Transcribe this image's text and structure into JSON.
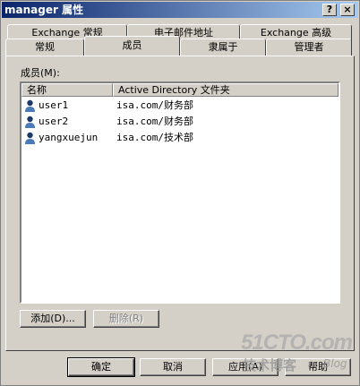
{
  "window": {
    "title": "manager 属性",
    "help": "?",
    "close": "×"
  },
  "tabs_back": [
    "Exchange 常规",
    "电子邮件地址",
    "Exchange 高级"
  ],
  "tabs_front": [
    "常规",
    "成员",
    "隶属于",
    "管理者"
  ],
  "members_label": "成员(M):",
  "columns": [
    "名称",
    "Active Directory 文件夹"
  ],
  "members": [
    {
      "name": "user1",
      "folder": "isa.com/财务部"
    },
    {
      "name": "user2",
      "folder": "isa.com/财务部"
    },
    {
      "name": "yangxuejun",
      "folder": "isa.com/技术部"
    }
  ],
  "buttons": {
    "add": "添加(D)...",
    "remove": "删除(R)"
  },
  "footer": {
    "ok": "确定",
    "cancel": "取消",
    "apply": "应用(A)",
    "help": "帮助"
  },
  "watermark": {
    "site": "51CTO.com",
    "sub": "技术博客",
    "blog": "Blog"
  }
}
